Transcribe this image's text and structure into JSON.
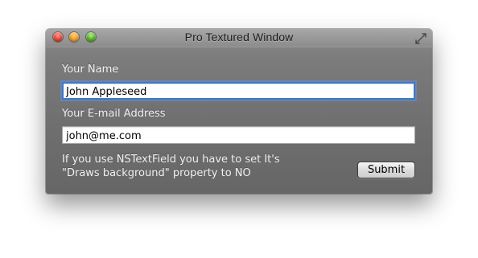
{
  "window": {
    "title": "Pro Textured Window",
    "traffic_lights": {
      "close": "close-button",
      "minimize": "minimize-button",
      "zoom": "zoom-button"
    },
    "fullscreen_icon": "fullscreen-icon"
  },
  "form": {
    "name_label": "Your Name",
    "name_value": "John Appleseed",
    "email_label": "Your E-mail Address",
    "email_value": "john@me.com",
    "note_line1": "If you use NSTextField you have to set It's",
    "note_line2": "\"Draws background\" property to NO",
    "submit_label": "Submit"
  },
  "colors": {
    "close": "#e74a3b",
    "minimize": "#f0a12b",
    "zoom": "#59b72a",
    "focus_ring": "#3d78c9"
  }
}
